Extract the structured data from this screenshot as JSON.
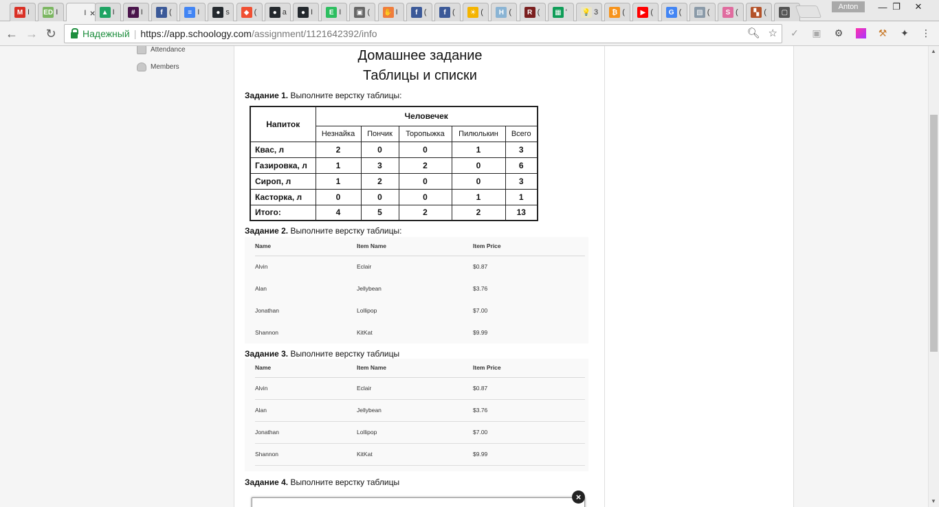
{
  "browser": {
    "tabs": [
      {
        "icon": "gmail-icon",
        "letter": "M",
        "color": "#d93025",
        "title": "I"
      },
      {
        "icon": "ed-icon",
        "letter": "ED",
        "color": "#7bb661",
        "title": "I"
      },
      {
        "icon": "schoology-icon",
        "letter": "",
        "color": "#ffffff",
        "title": "I",
        "active": true
      },
      {
        "icon": "drive-icon",
        "letter": "▲",
        "color": "#1fa463",
        "title": "I"
      },
      {
        "icon": "slack-icon",
        "letter": "#",
        "color": "#4a154b",
        "title": "I"
      },
      {
        "icon": "facebook-icon",
        "letter": "f",
        "color": "#3b5998",
        "title": "("
      },
      {
        "icon": "docs-icon",
        "letter": "≡",
        "color": "#4285f4",
        "title": "I"
      },
      {
        "icon": "github-icon",
        "letter": "●",
        "color": "#24292e",
        "title": "s"
      },
      {
        "icon": "git-icon",
        "letter": "◆",
        "color": "#f05033",
        "title": "("
      },
      {
        "icon": "github-icon",
        "letter": "●",
        "color": "#24292e",
        "title": "a"
      },
      {
        "icon": "github-icon",
        "letter": "●",
        "color": "#24292e",
        "title": "I"
      },
      {
        "icon": "evernote-icon",
        "letter": "E",
        "color": "#2dbe60",
        "title": "I"
      },
      {
        "icon": "shield-icon",
        "letter": "▣",
        "color": "#666666",
        "title": "("
      },
      {
        "icon": "hand-icon",
        "letter": "✋",
        "color": "#ef7d3c",
        "title": "I"
      },
      {
        "icon": "facebook-icon",
        "letter": "f",
        "color": "#3b5998",
        "title": "("
      },
      {
        "icon": "facebook-icon",
        "letter": "f",
        "color": "#3b5998",
        "title": "("
      },
      {
        "icon": "sun-icon",
        "letter": "☀",
        "color": "#f4b400",
        "title": "("
      },
      {
        "icon": "h-icon",
        "letter": "H",
        "color": "#8ab4d4",
        "title": "("
      },
      {
        "icon": "r-icon",
        "letter": "R",
        "color": "#7a1f1f",
        "title": "("
      },
      {
        "icon": "sheets-icon",
        "letter": "▦",
        "color": "#0f9d58",
        "title": "'"
      },
      {
        "icon": "bulb-icon",
        "letter": "💡",
        "color": "#e8e4c9",
        "title": "3"
      },
      {
        "icon": "bitcoin-icon",
        "letter": "₿",
        "color": "#f7931a",
        "title": "("
      },
      {
        "icon": "youtube-icon",
        "letter": "▶",
        "color": "#ff0000",
        "title": "("
      },
      {
        "icon": "google-icon",
        "letter": "G",
        "color": "#4285f4",
        "title": "("
      },
      {
        "icon": "image-icon",
        "letter": "▧",
        "color": "#8a9aa8",
        "title": "("
      },
      {
        "icon": "s-icon",
        "letter": "S",
        "color": "#e06c9f",
        "title": "("
      },
      {
        "icon": "grid-icon",
        "letter": "▚",
        "color": "#b4532a",
        "title": "("
      },
      {
        "icon": "chat-icon",
        "letter": "▢",
        "color": "#555555",
        "title": ""
      }
    ],
    "active_tab_title": "I",
    "profile_name": "Anton",
    "secure_label": "Надежный",
    "url_host": "https://app.schoology.com",
    "url_path": "/assignment/1121642392/info"
  },
  "sidebar": {
    "attendance": "Attendance",
    "members": "Members"
  },
  "main": {
    "title_line1": "Домашнее задание",
    "title_line2": "Таблицы и списки",
    "tasks": [
      {
        "label": "Задание 1.",
        "text": "Выполните верстку таблицы:"
      },
      {
        "label": "Задание 2.",
        "text": "Выполните верстку таблицы:"
      },
      {
        "label": "Задание 3.",
        "text": "Выполните верстку таблицы"
      },
      {
        "label": "Задание 4.",
        "text": "Выполните верстку таблицы"
      }
    ],
    "table1": {
      "corner": "Напиток",
      "group_header": "Человечек",
      "columns": [
        "Незнайка",
        "Пончик",
        "Торопыжка",
        "Пилюлькин",
        "Всего"
      ],
      "rows": [
        {
          "name": "Квас, л",
          "values": [
            "2",
            "0",
            "0",
            "1",
            "3"
          ]
        },
        {
          "name": "Газировка, л",
          "values": [
            "1",
            "3",
            "2",
            "0",
            "6"
          ]
        },
        {
          "name": "Сироп, л",
          "values": [
            "1",
            "2",
            "0",
            "0",
            "3"
          ]
        },
        {
          "name": "Касторка, л",
          "values": [
            "0",
            "0",
            "0",
            "1",
            "1"
          ]
        },
        {
          "name": "Итого:",
          "values": [
            "4",
            "5",
            "2",
            "2",
            "13"
          ]
        }
      ]
    },
    "table2": {
      "headers": [
        "Name",
        "Item Name",
        "Item Price"
      ],
      "rows": [
        [
          "Alvin",
          "Eclair",
          "$0.87"
        ],
        [
          "Alan",
          "Jellybean",
          "$3.76"
        ],
        [
          "Jonathan",
          "Lollipop",
          "$7.00"
        ],
        [
          "Shannon",
          "KitKat",
          "$9.99"
        ]
      ]
    },
    "table3": {
      "headers": [
        "Name",
        "Item Name",
        "Item Price"
      ],
      "rows": [
        [
          "Alvin",
          "Eclair",
          "$0.87"
        ],
        [
          "Alan",
          "Jellybean",
          "$3.76"
        ],
        [
          "Jonathan",
          "Lollipop",
          "$7.00"
        ],
        [
          "Shannon",
          "KitKat",
          "$9.99"
        ]
      ]
    },
    "close_symbol": "×"
  }
}
